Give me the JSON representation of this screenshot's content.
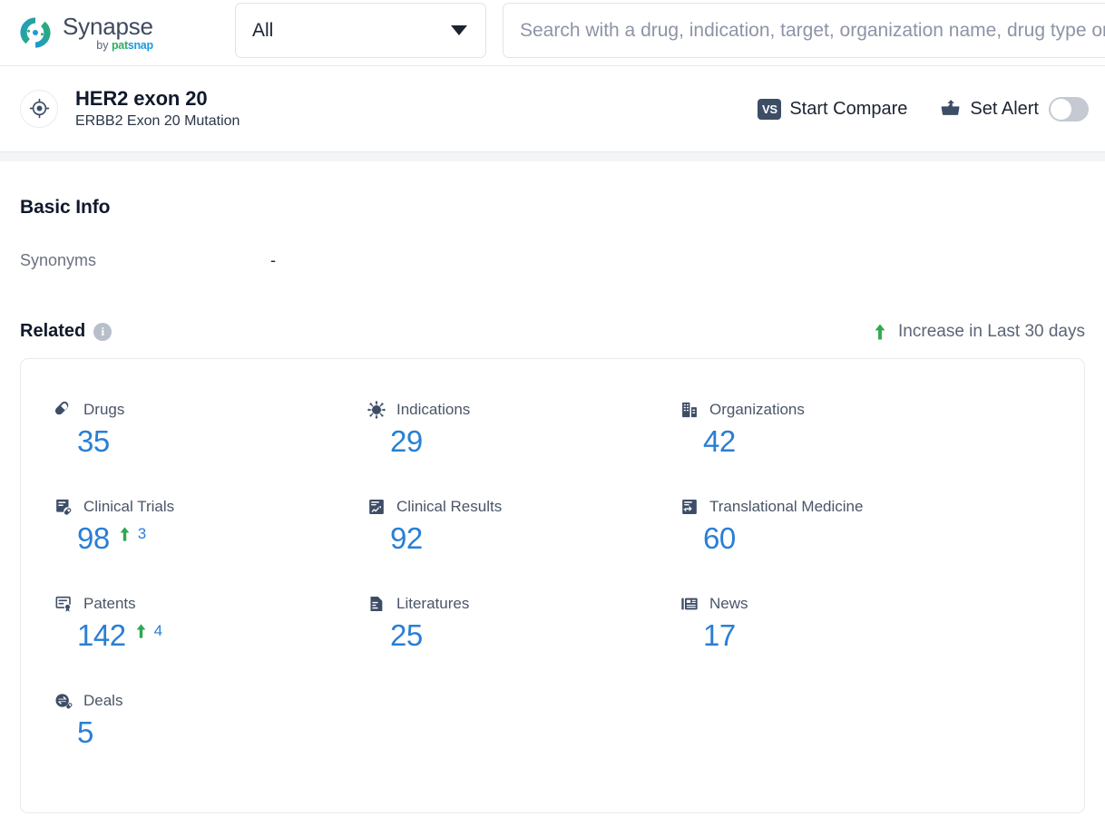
{
  "topbar": {
    "logo_name": "Synapse",
    "logo_by": "by ",
    "logo_pat": "pat",
    "logo_snap": "snap",
    "scope_selected": "All",
    "search_placeholder": "Search with a drug, indication, target, organization name, drug type or",
    "search_value": ""
  },
  "entity": {
    "name": "HER2 exon 20",
    "subtitle": "ERBB2 Exon 20 Mutation",
    "compare_label": "Start Compare",
    "compare_badge": "VS",
    "alert_label": "Set Alert",
    "alert_toggle_on": false
  },
  "basic_info": {
    "title": "Basic Info",
    "rows": [
      {
        "key": "Synonyms",
        "value": "-"
      }
    ]
  },
  "related": {
    "title": "Related",
    "info_glyph": "i",
    "legend_label": "Increase in Last 30 days",
    "legend_arrow": "↑",
    "items": [
      {
        "icon": "pill-icon",
        "label": "Drugs",
        "value": "35",
        "delta": ""
      },
      {
        "icon": "virus-icon",
        "label": "Indications",
        "value": "29",
        "delta": ""
      },
      {
        "icon": "building-icon",
        "label": "Organizations",
        "value": "42",
        "delta": ""
      },
      {
        "icon": "clinical-trial-icon",
        "label": "Clinical Trials",
        "value": "98",
        "delta": "3"
      },
      {
        "icon": "clinical-result-icon",
        "label": "Clinical Results",
        "value": "92",
        "delta": ""
      },
      {
        "icon": "translational-icon",
        "label": "Translational Medicine",
        "value": "60",
        "delta": ""
      },
      {
        "icon": "patent-icon",
        "label": "Patents",
        "value": "142",
        "delta": "4"
      },
      {
        "icon": "literature-icon",
        "label": "Literatures",
        "value": "25",
        "delta": ""
      },
      {
        "icon": "news-icon",
        "label": "News",
        "value": "17",
        "delta": ""
      },
      {
        "icon": "deal-icon",
        "label": "Deals",
        "value": "5",
        "delta": ""
      }
    ]
  },
  "colors": {
    "value_blue": "#2a7fd4",
    "increase_green": "#2fa84f",
    "icon_slate": "#3d4d66",
    "brand_green": "#2fae62",
    "brand_blue": "#1a9ae0"
  }
}
